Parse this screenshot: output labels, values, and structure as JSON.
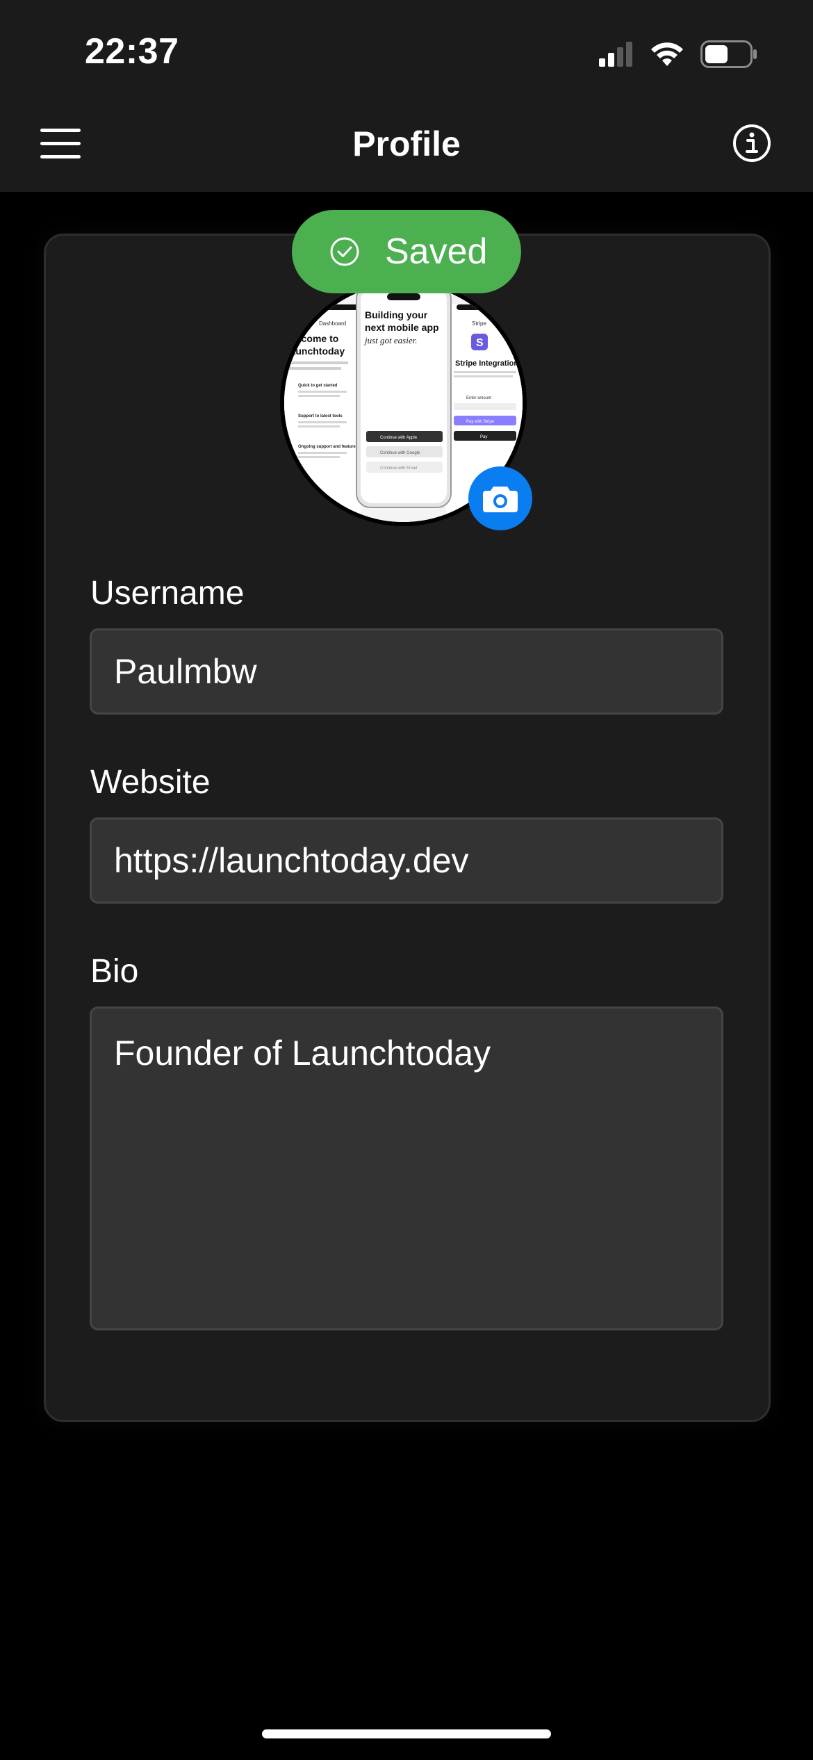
{
  "status_bar": {
    "time": "22:37",
    "icons": [
      "cellular-signal-icon",
      "wifi-icon",
      "battery-icon"
    ]
  },
  "nav": {
    "title": "Profile",
    "left_icon": "hamburger-menu-icon",
    "right_icon": "info-icon"
  },
  "toast": {
    "label": "Saved",
    "icon": "check-circle-icon",
    "color": "#4caf50"
  },
  "avatar": {
    "image_texts": {
      "center_heading_line1": "Building your",
      "center_heading_line2": "next mobile app",
      "center_tagline": "just got easier.",
      "center_button_1": "Continue with Apple",
      "center_button_2": "Continue with Google",
      "center_button_3": "Continue with Email",
      "left_heading_line1": "Welcome to",
      "left_heading_line2": "Launchtoday",
      "left_section_1": "Quick to get started",
      "left_section_2": "Support to latest tools",
      "left_section_3": "Ongoing support and features",
      "left_tab": "Dashboard",
      "right_tab": "Stripe",
      "right_heading": "Stripe Integration",
      "right_field": "Enter amount",
      "right_button_1": "Pay with Stripe",
      "right_button_2": "Pay"
    },
    "edit_icon": "camera-icon",
    "accent": "#0a7df0"
  },
  "form": {
    "username": {
      "label": "Username",
      "value": "Paulmbw"
    },
    "website": {
      "label": "Website",
      "value": "https://launchtoday.dev"
    },
    "bio": {
      "label": "Bio",
      "value": "Founder of Launchtoday"
    }
  }
}
